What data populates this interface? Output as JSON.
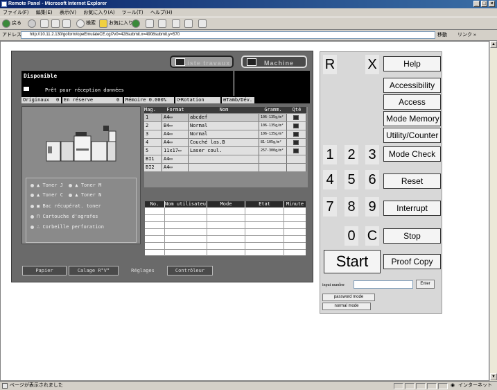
{
  "window": {
    "title": "Remote Panel - Microsoft Internet Explorer",
    "controls": [
      "_",
      "□",
      "×"
    ]
  },
  "menu": [
    "ファイル(F)",
    "編集(E)",
    "表示(V)",
    "お気に入り(A)",
    "ツール(T)",
    "ヘルプ(H)"
  ],
  "toolbar": {
    "back": "戻る",
    "search": "検索",
    "favorites": "お気に入り"
  },
  "address": {
    "label": "アドレス(D)",
    "url": "http://10.11.2.130/goform/opeEmulateCE.cgi?v0=428submit.x=4908submit.y=570",
    "go": "移動",
    "links": "リンク »"
  },
  "status": {
    "text": "ページが表示されました",
    "zone": "インターネット"
  },
  "panel": {
    "tab_list": "Liste travaux",
    "tab_machine": "Machine",
    "status_title": "Disponible",
    "status_msg": "Prêt pour réception données",
    "info": {
      "originals": "Originaux",
      "originals_val": "0",
      "reserve": "En réserve",
      "reserve_val": "0",
      "memory": "Mémoire",
      "memory_val": "0.000%",
      "rotation": "Rotation",
      "drum": "Tamb/Dév."
    },
    "toner": [
      {
        "left": "Toner J",
        "right": "Toner M"
      },
      {
        "left": "Toner C",
        "right": "Toner N"
      }
    ],
    "alerts": [
      "Bac récupérat. toner",
      "Cartouche d'agrafes",
      "Corbeille perforation"
    ],
    "tray_headers": [
      "Mag.",
      "Format",
      "Nom",
      "Gramm.",
      "Qté"
    ],
    "trays": [
      {
        "mag": "1",
        "format": "A4▭",
        "name": "abcdef",
        "gram": "106-135g/m²",
        "qty": true
      },
      {
        "mag": "2",
        "format": "B4▭",
        "name": "Normal",
        "gram": "106-135g/m²",
        "qty": true
      },
      {
        "mag": "3",
        "format": "A4▭",
        "name": "Normal",
        "gram": "106-135g/m²",
        "qty": true
      },
      {
        "mag": "4",
        "format": "A4▭",
        "name": "Couché las.B",
        "gram": "81-105g/m²",
        "qty": true
      },
      {
        "mag": "5",
        "format": "11x17▭",
        "name": "Laser coul.",
        "gram": "257-300g/m²",
        "qty": true
      },
      {
        "mag": "BI1",
        "format": "A4▭",
        "name": "",
        "gram": "",
        "qty": false
      },
      {
        "mag": "BI2",
        "format": "A4▭",
        "name": "",
        "gram": "",
        "qty": false
      }
    ],
    "job_headers": [
      "No.",
      "Nom utilisateur",
      "Mode",
      "Etat",
      "Minute"
    ],
    "bottom_buttons": [
      "Papier",
      "Calage R°V°",
      "Réglages",
      "Contrôleur"
    ]
  },
  "keypad": {
    "top": [
      "R",
      "X"
    ],
    "numbers": [
      "1",
      "2",
      "3",
      "4",
      "5",
      "6",
      "7",
      "8",
      "9",
      "0",
      "C"
    ],
    "start": "Start",
    "functions": [
      "Help",
      "Accessibility",
      "Access",
      "Mode Memory",
      "Utility/Counter",
      "Mode Check",
      "Reset",
      "Interrupt",
      "Stop",
      "Proof Copy"
    ],
    "input_label": "input number",
    "enter": "Enter",
    "password_mode": "password mode",
    "normal_mode": "normal mode"
  }
}
